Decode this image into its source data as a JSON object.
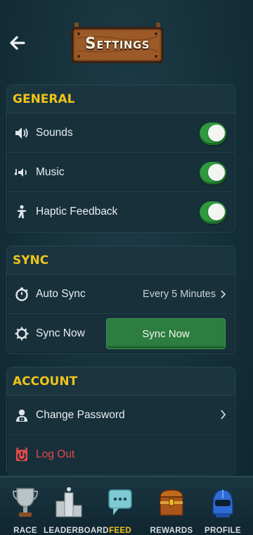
{
  "header": {
    "title": "Settings",
    "back_icon": "back-arrow-icon"
  },
  "sections": {
    "general": {
      "title": "GENERAL",
      "items": [
        {
          "label": "Sounds",
          "icon": "speaker-icon",
          "toggle_on": true
        },
        {
          "label": "Music",
          "icon": "music-speaker-icon",
          "toggle_on": true
        },
        {
          "label": "Haptic Feedback",
          "icon": "haptic-icon",
          "toggle_on": true
        }
      ]
    },
    "sync": {
      "title": "SYNC",
      "auto_sync": {
        "label": "Auto Sync",
        "value": "Every 5 Minutes",
        "icon": "timer-icon"
      },
      "sync_now": {
        "label": "Sync Now",
        "button_label": "Sync Now",
        "icon": "gear-icon"
      }
    },
    "account": {
      "title": "ACCOUNT",
      "change_password": {
        "label": "Change Password",
        "icon": "user-lock-icon"
      },
      "log_out": {
        "label": "Log Out",
        "icon": "logout-icon"
      }
    }
  },
  "bottom_nav": {
    "items": [
      {
        "label": "RACE",
        "icon": "trophy-icon",
        "active": false
      },
      {
        "label": "LEADERBOARD",
        "icon": "podium-icon",
        "active": false
      },
      {
        "label": "FEED",
        "icon": "chat-icon",
        "active": true
      },
      {
        "label": "REWARDS",
        "icon": "treasure-chest-icon",
        "active": false
      },
      {
        "label": "PROFILE",
        "icon": "helmet-icon",
        "active": false
      }
    ]
  },
  "colors": {
    "accent_yellow": "#f0c419",
    "toggle_green": "#2e9a3d",
    "button_green": "#2c7d3f",
    "danger_red": "#e84a4a",
    "background": "#16303a"
  }
}
